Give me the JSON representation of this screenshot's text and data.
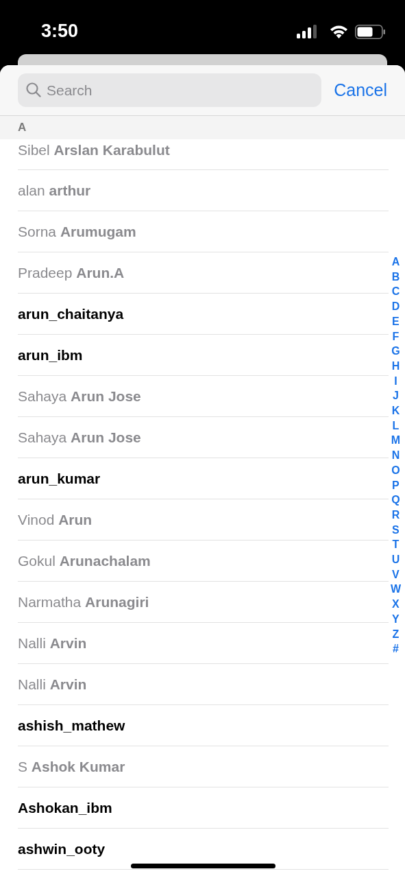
{
  "status_bar": {
    "time": "3:50"
  },
  "search": {
    "placeholder": "Search",
    "cancel": "Cancel"
  },
  "section": {
    "title": "A"
  },
  "contacts": [
    {
      "name": "Sibel **Arslan Karabulut**",
      "greyed": true
    },
    {
      "name": "alan **arthur**",
      "greyed": true
    },
    {
      "name": "Sorna **Arumugam**",
      "greyed": true
    },
    {
      "name": "Pradeep **Arun.A**",
      "greyed": true
    },
    {
      "name": "arun_chaitanya",
      "greyed": false
    },
    {
      "name": "arun_ibm",
      "greyed": false
    },
    {
      "name": "Sahaya **Arun Jose**",
      "greyed": true
    },
    {
      "name": "Sahaya **Arun Jose**",
      "greyed": true
    },
    {
      "name": "arun_kumar",
      "greyed": false
    },
    {
      "name": "Vinod **Arun**",
      "greyed": true
    },
    {
      "name": "Gokul **Arunachalam**",
      "greyed": true
    },
    {
      "name": "Narmatha **Arunagiri**",
      "greyed": true
    },
    {
      "name": "Nalli **Arvin**",
      "greyed": true
    },
    {
      "name": "Nalli **Arvin**",
      "greyed": true
    },
    {
      "name": "ashish_mathew",
      "greyed": false
    },
    {
      "name": "S **Ashok Kumar**",
      "greyed": true
    },
    {
      "name": "Ashokan_ibm",
      "greyed": false
    },
    {
      "name": "ashwin_ooty",
      "greyed": false
    }
  ],
  "index": [
    "A",
    "B",
    "C",
    "D",
    "E",
    "F",
    "G",
    "H",
    "I",
    "J",
    "K",
    "L",
    "M",
    "N",
    "O",
    "P",
    "Q",
    "R",
    "S",
    "T",
    "U",
    "V",
    "W",
    "X",
    "Y",
    "Z",
    "#"
  ]
}
